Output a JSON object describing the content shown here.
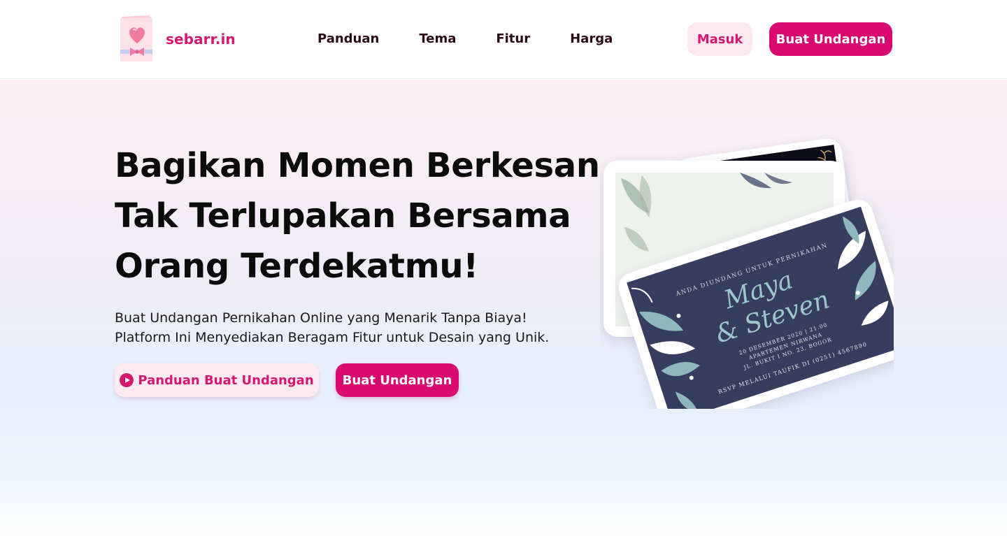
{
  "brand": {
    "name": "sebarr.in",
    "logo_icon": "heart-card-icon",
    "accent_color": "#d8096f"
  },
  "nav": {
    "items": [
      {
        "label": "Panduan"
      },
      {
        "label": "Tema"
      },
      {
        "label": "Fitur"
      },
      {
        "label": "Harga"
      }
    ]
  },
  "header_actions": {
    "login_label": "Masuk",
    "create_label": "Buat Undangan"
  },
  "hero": {
    "title_lines": [
      "Bagikan Momen Berkesan",
      "Tak Terlupakan Bersama",
      "Orang Terdekatmu!"
    ],
    "subtitle_lines": [
      "Buat Undangan Pernikahan Online yang Menarik Tanpa Biaya!",
      "Platform Ini Menyediakan Beragam Fitur untuk Desain yang Unik."
    ],
    "guide_button_label": "Panduan Buat Undangan",
    "guide_button_icon": "play-circle-icon",
    "create_button_label": "Buat Undangan"
  },
  "invitation_card": {
    "header": "ANDA DIUNDANG UNTUK PERNIKAHAN",
    "name_1": "Maya",
    "name_2": "& Steven",
    "date_line": "20 DESEMBER 2020 | 21.00",
    "venue_line": "APARTEMEN NIRWANA",
    "address_line": "JL. BUKIT I NO. 23, BOGOR",
    "rsvp_line": "RSVP MELALUI TAUFIK DI (0251) 4567890",
    "card_color": "#363d5e",
    "leaf_color": "#8fb8be"
  }
}
